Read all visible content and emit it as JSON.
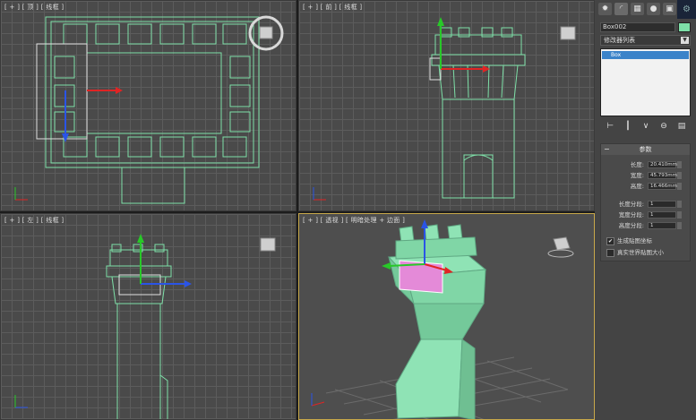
{
  "viewports": {
    "top": {
      "label": "[ + ] [ 顶 ] [ 线框 ]"
    },
    "front": {
      "label": "[ + ] [ 前 ] [ 线框 ]"
    },
    "left": {
      "label": "[ + ] [ 左 ] [ 线框 ]"
    },
    "perspective": {
      "label": "[ + ] [ 透视 ] [ 明暗处理 + 边面 ]"
    }
  },
  "colors": {
    "wireframe": "#7ee0a8",
    "shaded": "#8fe3b5",
    "selection": "#e48ad8",
    "axis_x": "#e02424",
    "axis_y": "#28c828",
    "axis_z": "#2a54e6",
    "active_border": "#c9a94a"
  },
  "command_panel": {
    "tabs": [
      "create-icon",
      "modify-icon",
      "hierarchy-icon",
      "motion-icon",
      "display-icon",
      "utilities-icon"
    ],
    "object_name": "Box002",
    "modifier_list": "修改器列表",
    "stack_items": [
      "Box"
    ],
    "parameters": {
      "title": "参数",
      "length_label": "长度:",
      "length_value": "20.410mm",
      "width_label": "宽度:",
      "width_value": "45.793mm",
      "height_label": "高度:",
      "height_value": "16.466mm",
      "length_segs_label": "长度分段:",
      "length_segs": "1",
      "width_segs_label": "宽度分段:",
      "width_segs": "1",
      "height_segs_label": "高度分段:",
      "height_segs": "1",
      "gen_uv_label": "生成贴图坐标",
      "real_world_label": "真实世界贴图大小"
    }
  }
}
